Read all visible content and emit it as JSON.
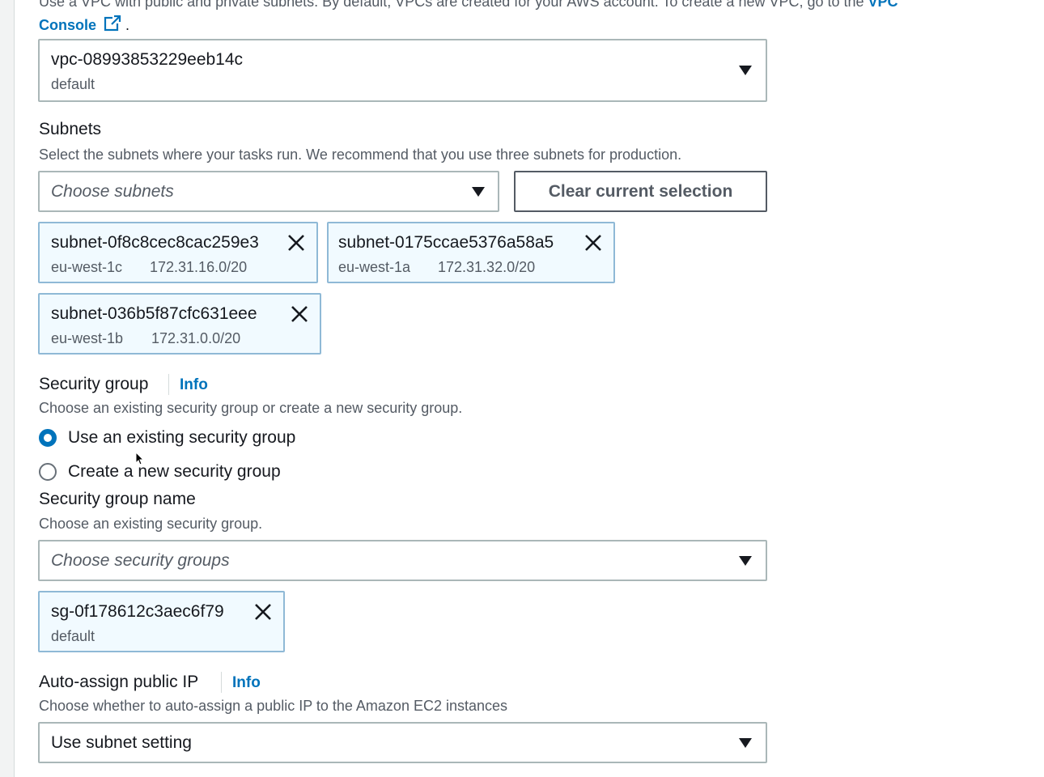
{
  "vpc": {
    "description": "Use a VPC with public and private subnets. By default, VPCs are created for your AWS account. To create a new VPC, go to the",
    "link_part1": "VPC",
    "link_part2": "Console",
    "suffix": ".",
    "selected_id": "vpc-08993853229eeb14c",
    "selected_sub": "default"
  },
  "subnets": {
    "label": "Subnets",
    "description": "Select the subnets where your tasks run. We recommend that you use three subnets for production.",
    "placeholder": "Choose subnets",
    "clear_label": "Clear current selection",
    "tokens": [
      {
        "id": "subnet-0f8c8cec8cac259e3",
        "az": "eu-west-1c",
        "cidr": "172.31.16.0/20"
      },
      {
        "id": "subnet-0175ccae5376a58a5",
        "az": "eu-west-1a",
        "cidr": "172.31.32.0/20"
      },
      {
        "id": "subnet-036b5f87cfc631eee",
        "az": "eu-west-1b",
        "cidr": "172.31.0.0/20"
      }
    ]
  },
  "security_group": {
    "label": "Security group",
    "info": "Info",
    "description": "Choose an existing security group or create a new security group.",
    "options": [
      {
        "label": "Use an existing security group",
        "selected": true
      },
      {
        "label": "Create a new security group",
        "selected": false
      }
    ],
    "name_label": "Security group name",
    "name_description": "Choose an existing security group.",
    "placeholder": "Choose security groups",
    "token": {
      "id": "sg-0f178612c3aec6f79",
      "sub": "default"
    }
  },
  "public_ip": {
    "label": "Auto-assign public IP",
    "info": "Info",
    "description": "Choose whether to auto-assign a public IP to the Amazon EC2 instances",
    "value": "Use subnet setting"
  },
  "colors": {
    "link": "#0073bb",
    "token_bg": "#f1faff",
    "token_border": "#8fb9d6"
  }
}
